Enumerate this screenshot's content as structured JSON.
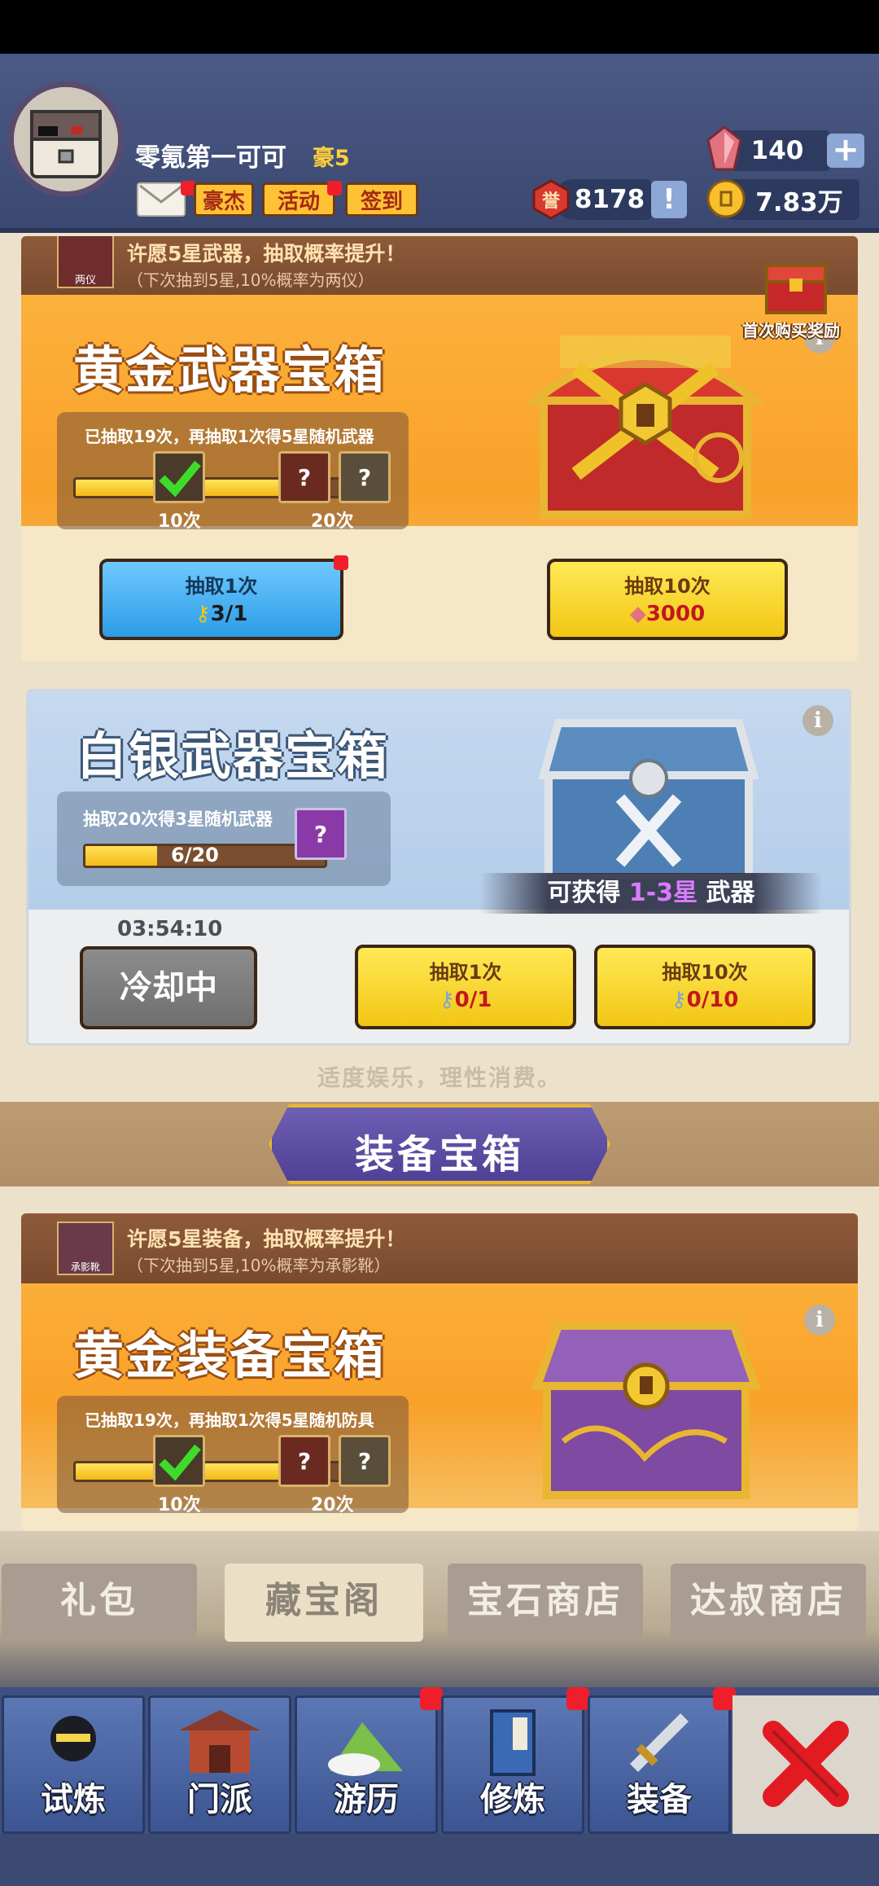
{
  "header": {
    "player_name": "零氪第一可可",
    "vip_label": "豪5",
    "buttons": {
      "haojie": "豪杰",
      "activity": "活动",
      "checkin": "签到"
    },
    "gems": "140",
    "honor": "8178",
    "coins": "7.83万",
    "honor_icon_text": "誉"
  },
  "gold_weapon": {
    "banner_line1": "许愿5星武器，抽取概率提升！",
    "banner_line2": "（下次抽到5星,10%概率为两仪）",
    "banner_thumb_label": "两仪",
    "first_purchase_label": "首次购买奖励",
    "title": "黄金武器宝箱",
    "progress_hint": "已抽取19次，再抽取1次得5星随机武器",
    "progress_fraction": 0.95,
    "tick1": "10次",
    "tick2": "20次",
    "draw1_label": "抽取1次",
    "draw1_cost": "3/1",
    "draw10_label": "抽取10次",
    "draw10_cost": "3000"
  },
  "silver_weapon": {
    "title": "白银武器宝箱",
    "progress_hint": "抽取20次得3星随机武器",
    "progress_text": "6/20",
    "progress_fraction": 0.3,
    "reward_prefix": "可获得",
    "reward_stars": "1-3星",
    "reward_suffix": "武器",
    "timer": "03:54:10",
    "cooldown_label": "冷却中",
    "draw1_label": "抽取1次",
    "draw1_cost": "0/1",
    "draw10_label": "抽取10次",
    "draw10_cost": "0/10"
  },
  "disclaimer": "适度娱乐，理性消费。",
  "section_title": "装备宝箱",
  "gold_equip": {
    "banner_line1": "许愿5星装备，抽取概率提升！",
    "banner_line2": "（下次抽到5星,10%概率为承影靴）",
    "banner_thumb_label": "承影靴",
    "title": "黄金装备宝箱",
    "progress_hint": "已抽取19次，再抽取1次得5星随机防具",
    "progress_fraction": 0.95,
    "tick1": "10次",
    "tick2": "20次"
  },
  "shop_tabs": [
    "礼包",
    "藏宝阁",
    "宝石商店",
    "达叔商店"
  ],
  "nav": [
    "试炼",
    "门派",
    "游历",
    "修炼",
    "装备"
  ],
  "colors": {
    "header_bg": "#4b5a86",
    "gold_accent": "#fcb640",
    "silver_bg": "#a9c6e6",
    "button_yellow": "#f2c614",
    "button_blue": "#2c9ce6",
    "badge_red": "#ee1f2a"
  },
  "icons": [
    "mail-icon",
    "gem-icon",
    "honor-icon",
    "coin-icon",
    "plus-icon",
    "info-icon",
    "key-icon",
    "check-icon",
    "close-icon"
  ]
}
